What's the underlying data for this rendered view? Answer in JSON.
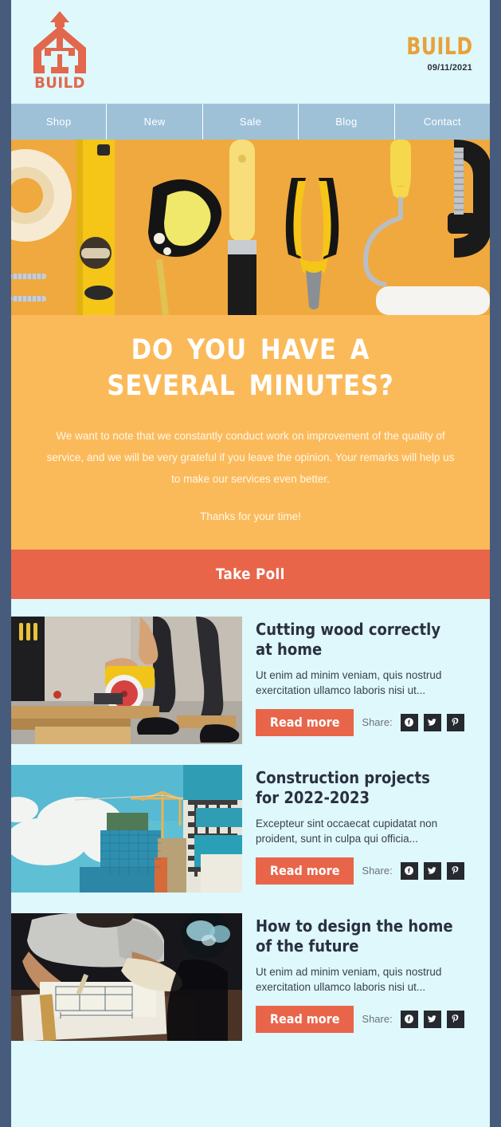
{
  "theme": {
    "frame_color": "#475B7D",
    "page_bg": "#DEF8FC",
    "nav_bg": "#9FC1D8",
    "hero_bg": "#FBBA5A",
    "accent_orange": "#E8654A",
    "brand_gold": "#E8A13A",
    "social_bg": "#26292F"
  },
  "header": {
    "logo_name": "build-house-arrow-logo",
    "logo_text": "BUILD",
    "brand_name": "BUILD",
    "date": "09/11/2021"
  },
  "nav": {
    "items": [
      {
        "label": "Shop"
      },
      {
        "label": "New"
      },
      {
        "label": "Sale"
      },
      {
        "label": "Blog"
      },
      {
        "label": "Contact"
      }
    ]
  },
  "hero": {
    "image_alt": "flat-lay of construction tools on orange background: masking tape, spirit level, tape measure, paintbrush, pliers, paint roller, c-clamp, screws",
    "heading": "DO YOU  HAVE  A SEVERAL MINUTES?",
    "body": "We want to note that we constantly conduct work on improvement of the quality of service, and we will be very grateful if you leave the opinion. Your remarks will help us to make our services even better.",
    "thanks": "Thanks for your time!",
    "cta_label": "Take Poll"
  },
  "articles": {
    "share_label": "Share:",
    "read_more_label": "Read more",
    "social": [
      {
        "name": "facebook-icon"
      },
      {
        "name": "twitter-icon"
      },
      {
        "name": "pinterest-icon"
      }
    ],
    "items": [
      {
        "title": "Cutting wood correctly at home",
        "desc": "Ut enim ad minim veniam, quis nostrud exercitation ullamco laboris nisi ut...",
        "image_alt": "worker using a yellow circular saw to cut lumber planks on a construction site",
        "read_more_label": "Read more",
        "share_label": "Share:"
      },
      {
        "title": "Construction projects for 2022-2023",
        "desc": "Excepteur sint occaecat cupidatat non proident, sunt in culpa qui officia...",
        "image_alt": "high-rise buildings under construction with tower cranes against a blue cloudy sky",
        "read_more_label": "Read more",
        "share_label": "Share:"
      },
      {
        "title": "How to design the home of the future",
        "desc": "Ut enim ad minim veniam, quis nostrud exercitation ullamco laboris nisi ut...",
        "image_alt": "architect drawing blueprints with a ruler on a wooden desk in dim light",
        "read_more_label": "Read more",
        "share_label": "Share:"
      }
    ]
  }
}
